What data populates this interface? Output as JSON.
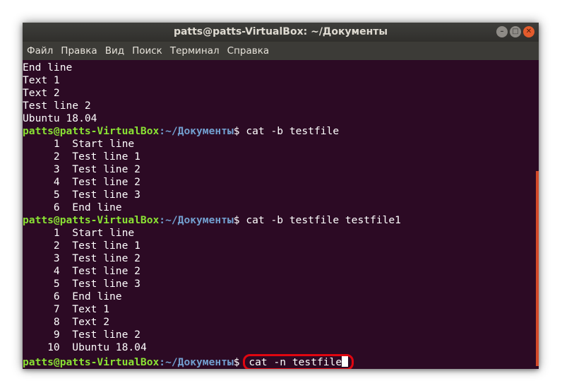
{
  "window": {
    "title": "patts@patts-VirtualBox: ~/Документы"
  },
  "menu": [
    "Файл",
    "Правка",
    "Вид",
    "Поиск",
    "Терминал",
    "Справка"
  ],
  "prompt": {
    "user_host": "patts@patts-VirtualBox",
    "path": ":~/Документы",
    "symbol": "$"
  },
  "lines": [
    {
      "type": "out",
      "text": "End line"
    },
    {
      "type": "out",
      "text": "Text 1"
    },
    {
      "type": "out",
      "text": "Text 2"
    },
    {
      "type": "out",
      "text": "Test line 2"
    },
    {
      "type": "out",
      "text": "Ubuntu 18.04"
    },
    {
      "type": "cmd",
      "text": " cat -b testfile"
    },
    {
      "type": "out",
      "text": "     1\tStart line"
    },
    {
      "type": "out",
      "text": "     2\tTest line 1"
    },
    {
      "type": "out",
      "text": "     3\tTest line 2"
    },
    {
      "type": "out",
      "text": "     4\tTest line 2"
    },
    {
      "type": "out",
      "text": "     5\tTest line 3"
    },
    {
      "type": "out",
      "text": "     6\tEnd line"
    },
    {
      "type": "cmd",
      "text": " cat -b testfile testfile1"
    },
    {
      "type": "out",
      "text": "     1\tStart line"
    },
    {
      "type": "out",
      "text": "     2\tTest line 1"
    },
    {
      "type": "out",
      "text": "     3\tTest line 2"
    },
    {
      "type": "out",
      "text": "     4\tTest line 2"
    },
    {
      "type": "out",
      "text": "     5\tTest line 3"
    },
    {
      "type": "out",
      "text": "     6\tEnd line"
    },
    {
      "type": "out",
      "text": "     7\tText 1"
    },
    {
      "type": "out",
      "text": "     8\tText 2"
    },
    {
      "type": "out",
      "text": "     9\tTest line 2"
    },
    {
      "type": "out",
      "text": "    10\tUbuntu 18.04"
    }
  ],
  "current_input": "cat -n testfile",
  "colors": {
    "background": "#2c0a24",
    "user_host": "#8ae234",
    "path": "#729fcf",
    "highlight": "#e10610"
  },
  "icons": {
    "minimize": "minimize-icon",
    "maximize": "maximize-icon",
    "close": "close-icon"
  }
}
